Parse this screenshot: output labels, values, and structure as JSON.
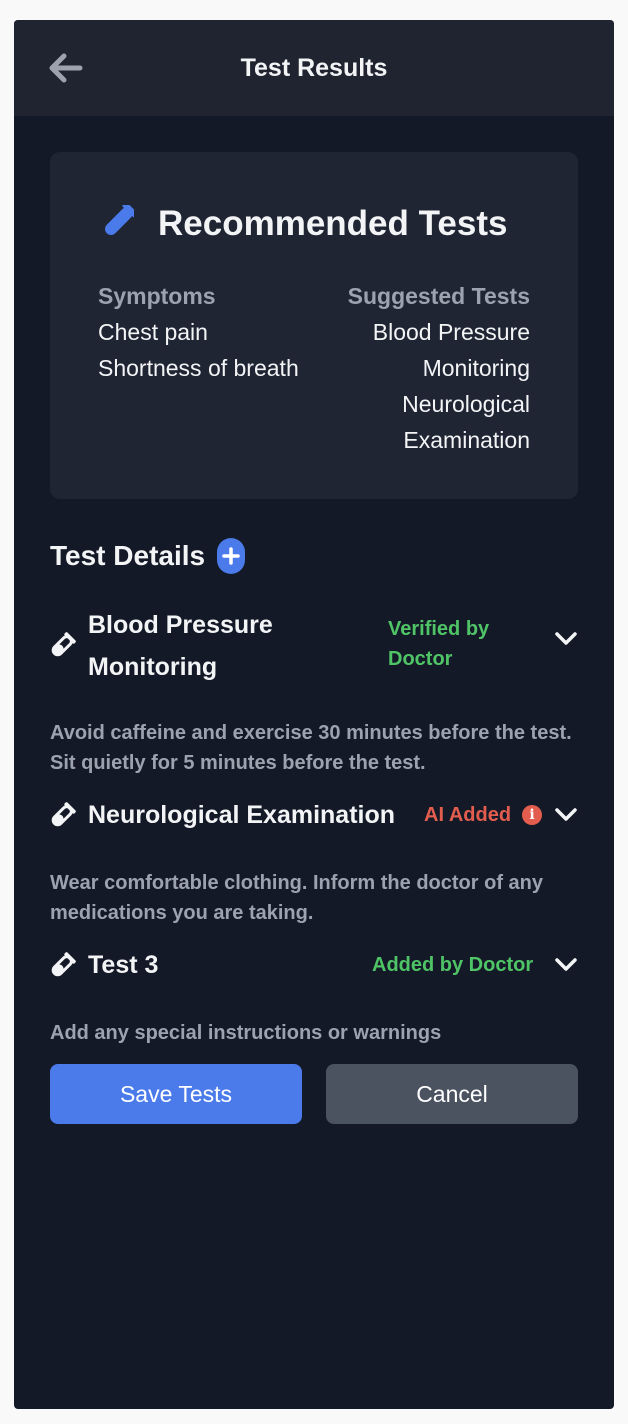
{
  "header": {
    "title": "Test Results"
  },
  "recommended": {
    "title": "Recommended Tests",
    "symptoms_label": "Symptoms",
    "symptoms": [
      "Chest pain",
      "Shortness of breath"
    ],
    "tests_label": "Suggested Tests",
    "tests": [
      "Blood Pressure Monitoring",
      "Neurological Examination"
    ]
  },
  "details": {
    "title": "Test Details",
    "tests": [
      {
        "name_line1": "Blood Pressure",
        "name_line2": "Monitoring",
        "status_line1": "Verified by",
        "status_line2": "Doctor",
        "status_color": "#4fc466",
        "instructions": "Avoid caffeine and exercise 30 minutes before the test. Sit quietly for 5 minutes before the test."
      },
      {
        "name": "Neurological Examination",
        "status": "AI Added",
        "status_color": "#e35d4f",
        "instructions": "Wear comfortable clothing. Inform the doctor of any medications you are taking."
      },
      {
        "name": "Test 3",
        "status": "Added by Doctor",
        "status_color": "#4fc466",
        "instructions": "Add any special instructions or warnings"
      }
    ]
  },
  "actions": {
    "save_label": "Save Tests",
    "cancel_label": "Cancel"
  },
  "colors": {
    "accent": "#4b7bea",
    "background": "#141927",
    "card": "#1f2533",
    "header": "#1f2430"
  }
}
